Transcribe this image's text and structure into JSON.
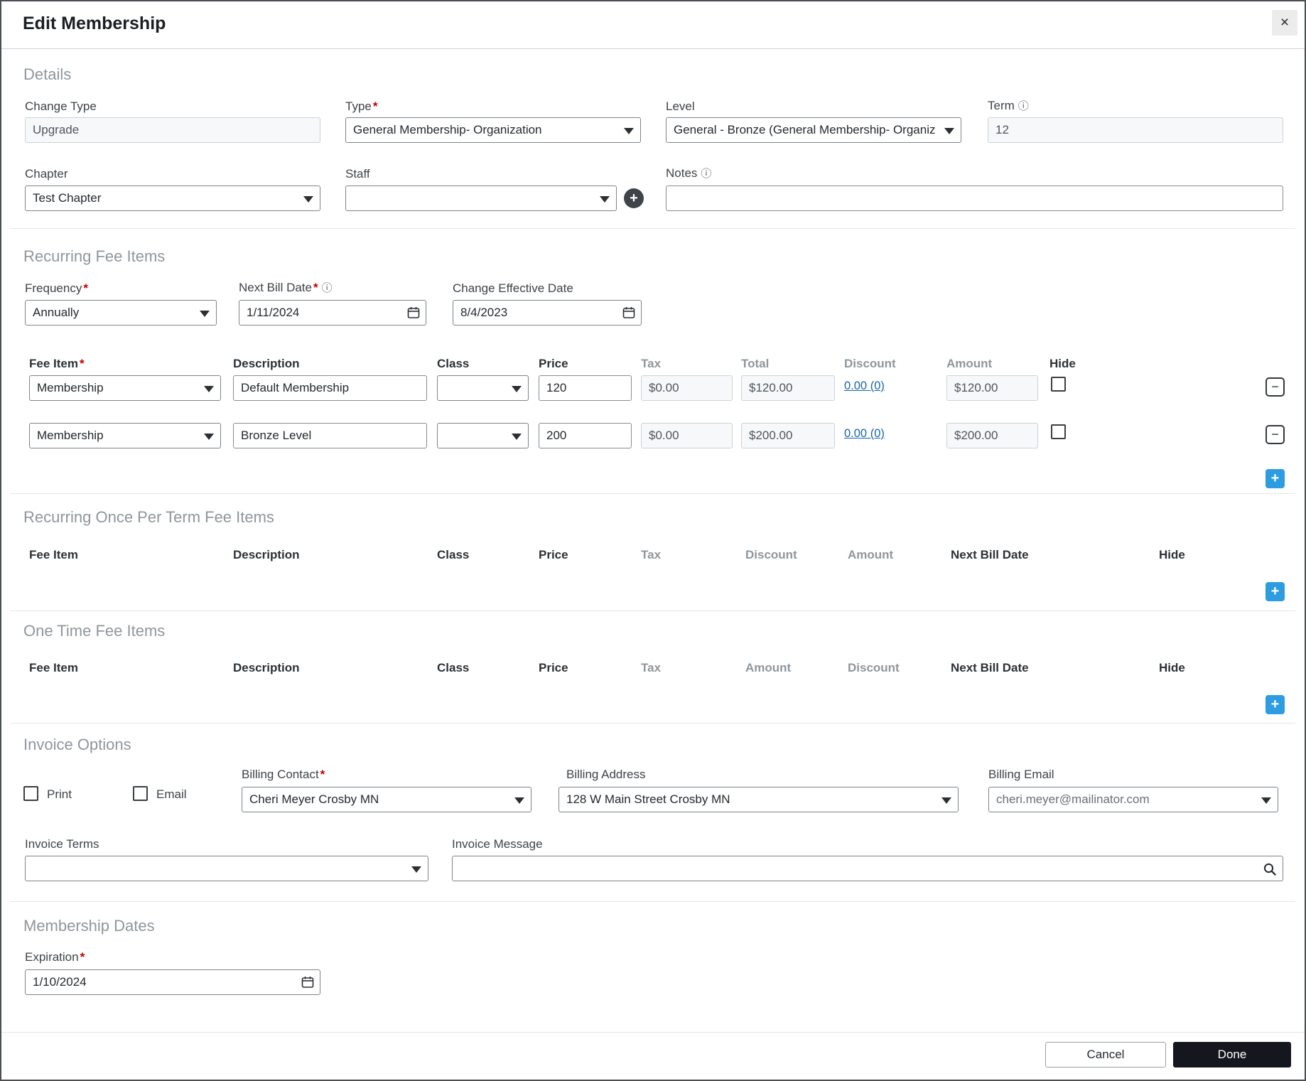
{
  "icons": {
    "close": "×",
    "plus": "+",
    "minus": "−",
    "info": "ⓘ",
    "required": "*"
  },
  "header": {
    "title": "Edit Membership"
  },
  "details": {
    "heading": "Details",
    "change_type_label": "Change Type",
    "change_type_value": "Upgrade",
    "type_label": "Type",
    "type_value": "General Membership- Organization",
    "level_label": "Level",
    "level_value": "General - Bronze (General Membership- Organiz",
    "term_label": "Term",
    "term_value": "12",
    "chapter_label": "Chapter",
    "chapter_value": "Test Chapter",
    "staff_label": "Staff",
    "staff_value": "",
    "notes_label": "Notes",
    "notes_value": ""
  },
  "recurring": {
    "heading": "Recurring Fee Items",
    "frequency_label": "Frequency",
    "frequency_value": "Annually",
    "next_bill_date_label": "Next Bill Date",
    "next_bill_date_value": "1/11/2024",
    "change_effective_date_label": "Change Effective Date",
    "change_effective_date_value": "8/4/2023",
    "headers": {
      "fee_item": "Fee Item",
      "description": "Description",
      "class": "Class",
      "price": "Price",
      "tax": "Tax",
      "total": "Total",
      "discount": "Discount",
      "amount": "Amount",
      "hide": "Hide"
    },
    "rows": [
      {
        "fee_item": "Membership",
        "description": "Default Membership",
        "class": "",
        "price": "120",
        "tax": "$0.00",
        "total": "$120.00",
        "discount": "0.00 (0)",
        "amount": "$120.00"
      },
      {
        "fee_item": "Membership",
        "description": "Bronze Level",
        "class": "",
        "price": "200",
        "tax": "$0.00",
        "total": "$200.00",
        "discount": "0.00 (0)",
        "amount": "$200.00"
      }
    ]
  },
  "once_per_term": {
    "heading": "Recurring Once Per Term Fee Items",
    "headers": {
      "fee_item": "Fee Item",
      "description": "Description",
      "class": "Class",
      "price": "Price",
      "tax": "Tax",
      "discount": "Discount",
      "amount": "Amount",
      "next_bill_date": "Next Bill Date",
      "hide": "Hide"
    }
  },
  "one_time": {
    "heading": "One Time Fee Items",
    "headers": {
      "fee_item": "Fee Item",
      "description": "Description",
      "class": "Class",
      "price": "Price",
      "tax": "Tax",
      "amount": "Amount",
      "discount": "Discount",
      "next_bill_date": "Next Bill Date",
      "hide": "Hide"
    }
  },
  "invoice": {
    "heading": "Invoice Options",
    "print_label": "Print",
    "email_label": "Email",
    "billing_contact_label": "Billing Contact",
    "billing_contact_value": "Cheri Meyer Crosby MN",
    "billing_address_label": "Billing Address",
    "billing_address_value": "128 W Main Street Crosby MN",
    "billing_email_label": "Billing Email",
    "billing_email_value": "cheri.meyer@mailinator.com",
    "invoice_terms_label": "Invoice Terms",
    "invoice_terms_value": "",
    "invoice_message_label": "Invoice Message",
    "invoice_message_value": ""
  },
  "dates": {
    "heading": "Membership Dates",
    "expiration_label": "Expiration",
    "expiration_value": "1/10/2024"
  },
  "footer": {
    "cancel": "Cancel",
    "done": "Done"
  }
}
